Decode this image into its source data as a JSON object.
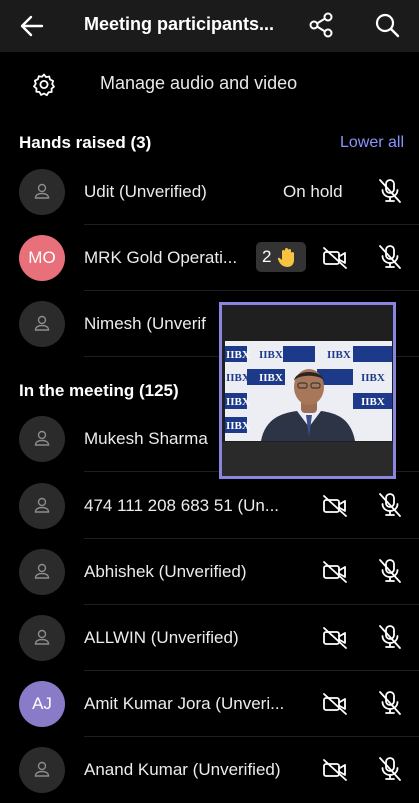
{
  "header": {
    "title": "Meeting participants..."
  },
  "manage": {
    "label": "Manage audio and video"
  },
  "hands_raised": {
    "heading": "Hands raised (3)",
    "action": "Lower all"
  },
  "in_meeting": {
    "heading": "In the meeting (125)"
  },
  "hand_rows": [
    {
      "name": "Udit (Unverified)",
      "status": "On hold"
    },
    {
      "initials": "MO",
      "name": "MRK Gold Operati...",
      "hand_count": "2",
      "avatar_color": "#e8707a"
    },
    {
      "name": "Nimesh (Unverif"
    }
  ],
  "meeting_rows": [
    {
      "name": "Mukesh Sharma"
    },
    {
      "name": "474 111 208 683 51 (Un..."
    },
    {
      "name": "Abhishek (Unverified)"
    },
    {
      "name": "ALLWIN (Unverified)"
    },
    {
      "initials": "AJ",
      "name": "Amit Kumar Jora (Unveri...",
      "avatar_color": "#8a7bc8"
    },
    {
      "name": "Anand Kumar (Unverified)"
    }
  ],
  "video_backdrop_text": "IIBX"
}
